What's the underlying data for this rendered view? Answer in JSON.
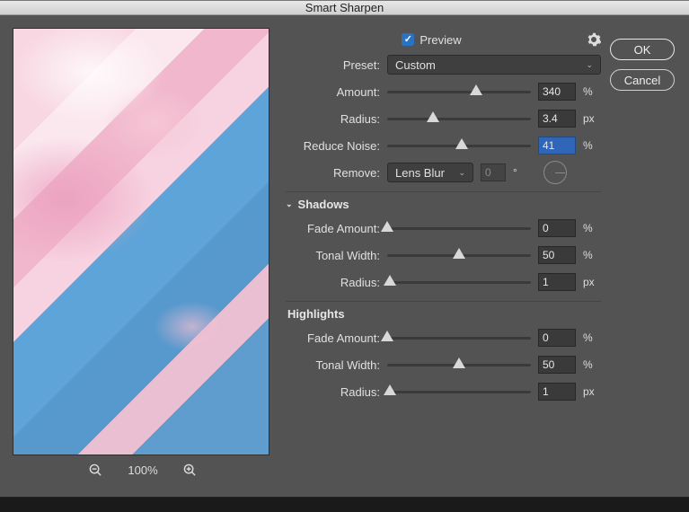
{
  "title": "Smart Sharpen",
  "preview_label": "Preview",
  "preview_checked": true,
  "buttons": {
    "ok": "OK",
    "cancel": "Cancel"
  },
  "zoom": {
    "level": "100%"
  },
  "preset": {
    "label": "Preset:",
    "value": "Custom"
  },
  "amount": {
    "label": "Amount:",
    "value": "340",
    "unit": "%",
    "pos": 62
  },
  "radius": {
    "label": "Radius:",
    "value": "3.4",
    "unit": "px",
    "pos": 32
  },
  "reduce_noise": {
    "label": "Reduce Noise:",
    "value": "41",
    "unit": "%",
    "pos": 52,
    "selected": true
  },
  "remove": {
    "label": "Remove:",
    "value": "Lens Blur",
    "angle": "0",
    "angle_unit": "°"
  },
  "shadows": {
    "title": "Shadows",
    "fade": {
      "label": "Fade Amount:",
      "value": "0",
      "unit": "%",
      "pos": 0
    },
    "tonal": {
      "label": "Tonal Width:",
      "value": "50",
      "unit": "%",
      "pos": 50
    },
    "radius": {
      "label": "Radius:",
      "value": "1",
      "unit": "px",
      "pos": 2
    }
  },
  "highlights": {
    "title": "Highlights",
    "fade": {
      "label": "Fade Amount:",
      "value": "0",
      "unit": "%",
      "pos": 0
    },
    "tonal": {
      "label": "Tonal Width:",
      "value": "50",
      "unit": "%",
      "pos": 50
    },
    "radius": {
      "label": "Radius:",
      "value": "1",
      "unit": "px",
      "pos": 2
    }
  }
}
